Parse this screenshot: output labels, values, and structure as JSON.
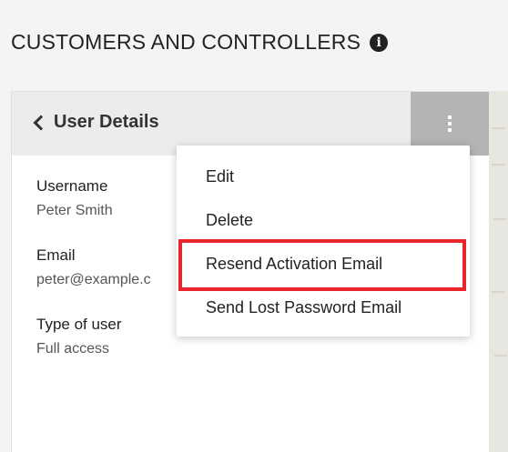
{
  "page": {
    "title": "CUSTOMERS AND CONTROLLERS",
    "info_icon": "info-circle-icon",
    "info_glyph": "i"
  },
  "panel": {
    "back_icon": "chevron-left-icon",
    "title": "User Details",
    "menu_icon": "kebab-menu-icon"
  },
  "fields": [
    {
      "label": "Username",
      "value": "Peter Smith"
    },
    {
      "label": "Email",
      "value": "peter@example.c"
    },
    {
      "label": "Type of user",
      "value": "Full access"
    }
  ],
  "menu": {
    "items": [
      {
        "label": "Edit"
      },
      {
        "label": "Delete"
      },
      {
        "label": "Resend Activation Email",
        "highlighted": true
      },
      {
        "label": "Send Lost Password Email"
      }
    ]
  },
  "colors": {
    "highlight": "#e8262b",
    "header_bg": "#ececec",
    "menu_toggle_bg": "#b4b4b4"
  }
}
